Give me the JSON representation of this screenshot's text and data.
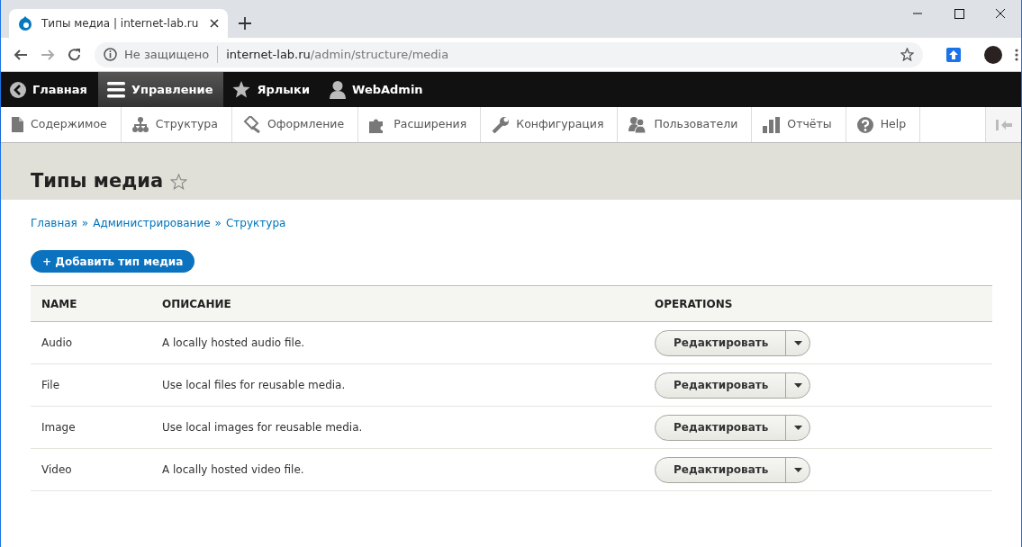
{
  "browser": {
    "tab_title": "Типы медиа | internet-lab.ru",
    "security": "Не защищено",
    "url_host": "internet-lab.ru",
    "url_path": "/admin/structure/media"
  },
  "toolbar": [
    {
      "label": "Главная",
      "selected": false
    },
    {
      "label": "Управление",
      "selected": true
    },
    {
      "label": "Ярлыки",
      "selected": false
    },
    {
      "label": "WebAdmin",
      "selected": false
    }
  ],
  "tray": [
    {
      "label": "Содержимое"
    },
    {
      "label": "Структура"
    },
    {
      "label": "Оформление"
    },
    {
      "label": "Расширения"
    },
    {
      "label": "Конфигурация"
    },
    {
      "label": "Пользователи"
    },
    {
      "label": "Отчёты"
    },
    {
      "label": "Help"
    }
  ],
  "page_title": "Типы медиа",
  "breadcrumb": [
    "Главная",
    "Администрирование",
    "Структура"
  ],
  "breadcrumb_separator": "»",
  "add_button": "+ Добавить тип медиа",
  "table": {
    "columns": [
      "NAME",
      "ОПИСАНИЕ",
      "OPERATIONS"
    ],
    "rows": [
      {
        "name": "Audio",
        "description": "A locally hosted audio file.",
        "operation": "Редактировать"
      },
      {
        "name": "File",
        "description": "Use local files for reusable media.",
        "operation": "Редактировать"
      },
      {
        "name": "Image",
        "description": "Use local images for reusable media.",
        "operation": "Редактировать"
      },
      {
        "name": "Video",
        "description": "A locally hosted video file.",
        "operation": "Редактировать"
      }
    ]
  }
}
